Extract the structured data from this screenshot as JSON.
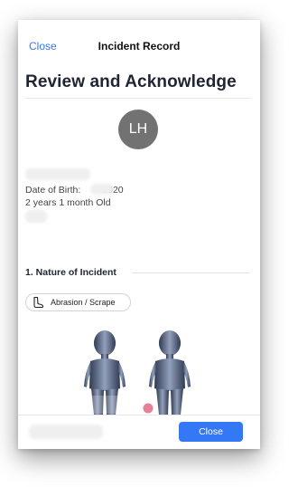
{
  "nav": {
    "close_label": "Close",
    "title": "Incident Record"
  },
  "review": {
    "heading": "Review and Acknowledge"
  },
  "child": {
    "initials": "LH",
    "dob_label": "Date of Birth:",
    "dob_year": "2020",
    "age": "2 years 1 month Old"
  },
  "incident": {
    "section_title": "1. Nature of Incident",
    "type_label": "Abrasion / Scrape",
    "type_icon": "foot-icon"
  },
  "colors": {
    "accent": "#3478f6",
    "avatar": "#727272",
    "marker": "#e06a88"
  },
  "footer": {
    "close_label": "Close"
  }
}
